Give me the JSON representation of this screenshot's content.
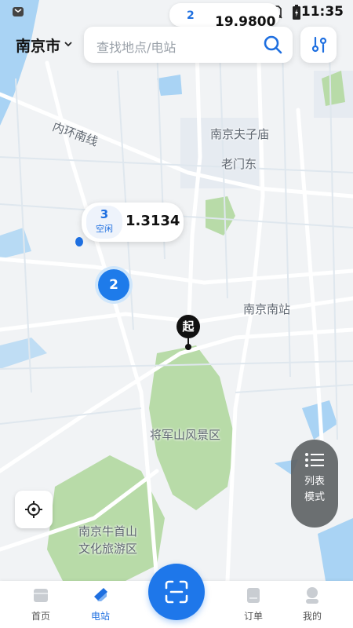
{
  "status_bar": {
    "time": "11:35",
    "icons": [
      "app-notification-icon",
      "wifi-icon",
      "no-sim-icon",
      "battery-charging-icon"
    ]
  },
  "top_bubble": {
    "count": "2",
    "price": "19.9800"
  },
  "header": {
    "city": "南京市",
    "search_placeholder": "查找地点/电站"
  },
  "map": {
    "labels": {
      "road_inner_ring": "内环南线",
      "fuzimiao": "南京夫子庙",
      "laomendong": "老门东",
      "south_station": "南京南站",
      "jiangjunshan": "将军山风景区",
      "niushoushan_1": "南京牛首山",
      "niushoushan_2": "文化旅游区"
    },
    "colors": {
      "water": "#a9d3f4",
      "park": "#b8dba8",
      "road": "#ffffff",
      "road_major": "#dfe7ee"
    }
  },
  "station_bubble": {
    "count": "3",
    "status": "空闲",
    "price": "1.3134"
  },
  "cluster": {
    "count": "2"
  },
  "start_marker": {
    "label": "起"
  },
  "list_mode": {
    "line1": "列表",
    "line2": "模式"
  },
  "tabs": [
    {
      "label": "首页",
      "icon": "home-icon",
      "active": false
    },
    {
      "label": "电站",
      "icon": "station-icon",
      "active": true
    },
    {
      "label": "订单",
      "icon": "order-icon",
      "active": false
    },
    {
      "label": "我的",
      "icon": "profile-icon",
      "active": false
    }
  ],
  "colors": {
    "accent": "#1e6fe0",
    "cluster": "#1e7bea"
  }
}
